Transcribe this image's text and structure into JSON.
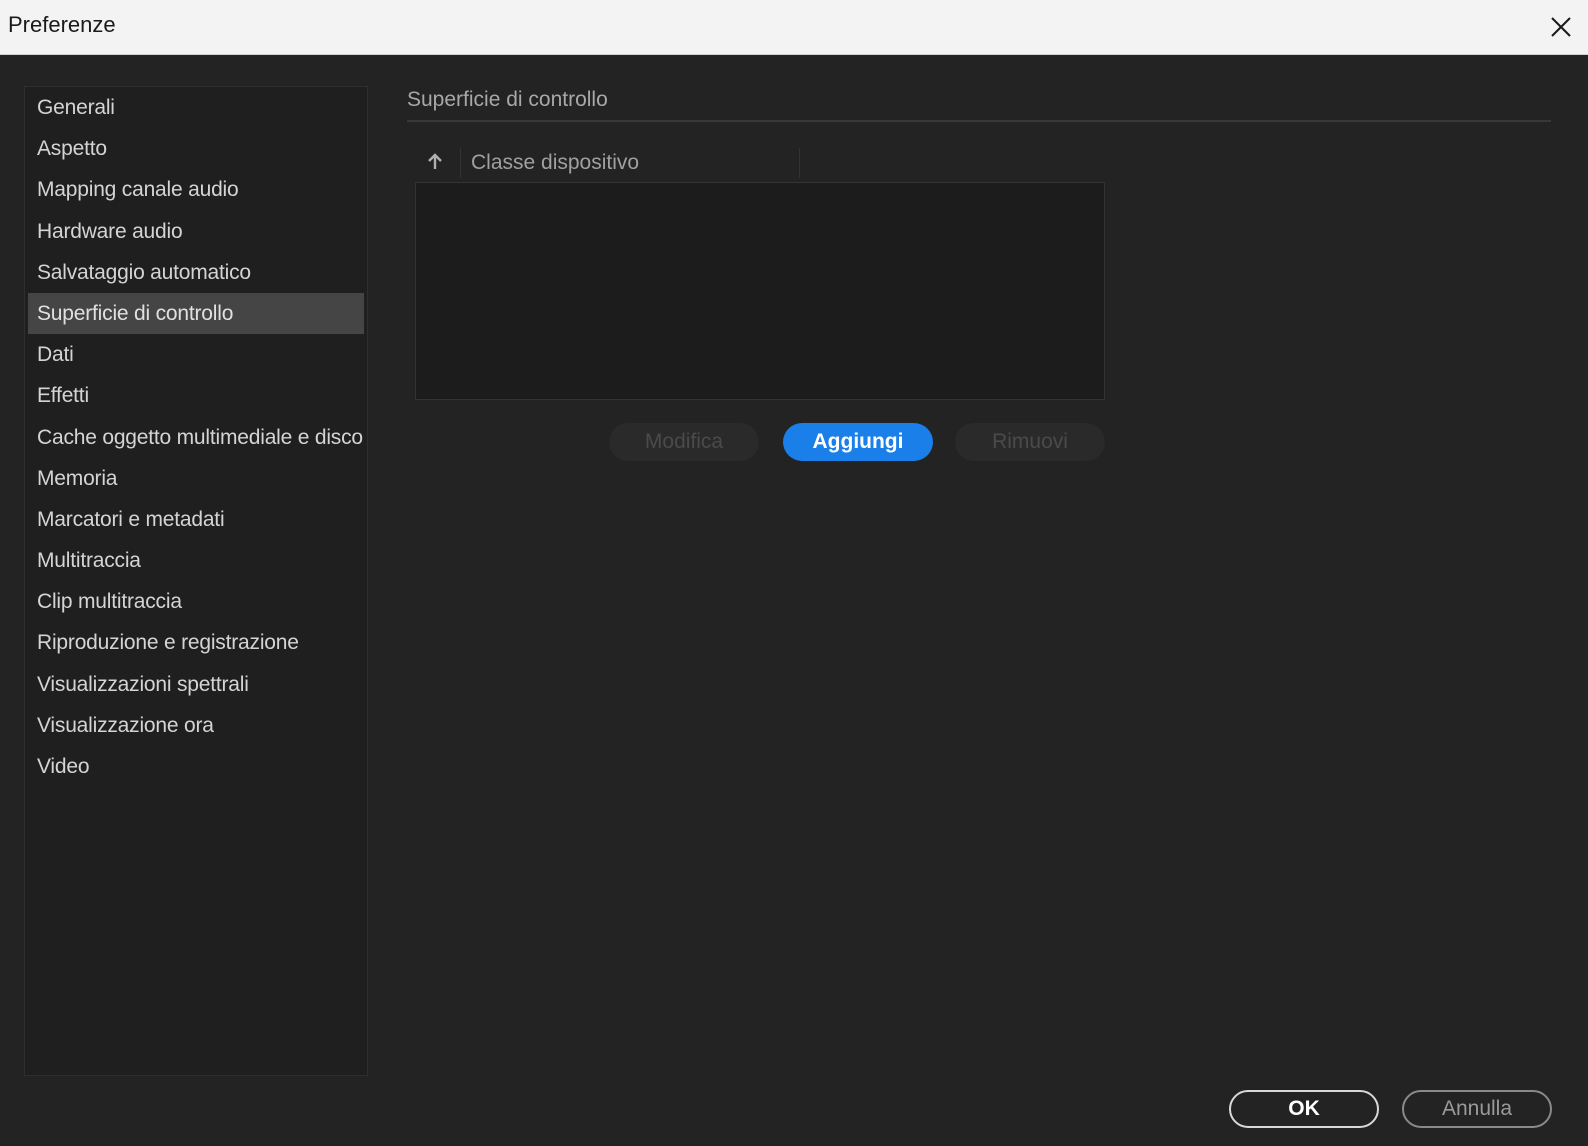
{
  "window": {
    "title": "Preferenze"
  },
  "sidebar": {
    "items": [
      {
        "label": "Generali"
      },
      {
        "label": "Aspetto"
      },
      {
        "label": "Mapping canale audio"
      },
      {
        "label": "Hardware audio"
      },
      {
        "label": "Salvataggio automatico"
      },
      {
        "label": "Superficie di controllo",
        "selected": true
      },
      {
        "label": "Dati"
      },
      {
        "label": "Effetti"
      },
      {
        "label": "Cache oggetto multimediale e disco"
      },
      {
        "label": "Memoria"
      },
      {
        "label": "Marcatori e metadati"
      },
      {
        "label": "Multitraccia"
      },
      {
        "label": "Clip multitraccia"
      },
      {
        "label": "Riproduzione e registrazione"
      },
      {
        "label": "Visualizzazioni spettrali"
      },
      {
        "label": "Visualizzazione ora"
      },
      {
        "label": "Video"
      }
    ]
  },
  "main": {
    "section_title": "Superficie di controllo",
    "table": {
      "column_header": "Classe dispositivo",
      "sort_icon": "arrow-up-icon",
      "rows": []
    },
    "buttons": {
      "edit": "Modifica",
      "add": "Aggiungi",
      "remove": "Rimuovi"
    }
  },
  "footer": {
    "ok": "OK",
    "cancel": "Annulla"
  },
  "colors": {
    "background": "#232323",
    "accent": "#1a7fe8",
    "selected_item": "#454545",
    "titlebar": "#f3f3f3"
  },
  "icons": {
    "close": "close-icon"
  }
}
